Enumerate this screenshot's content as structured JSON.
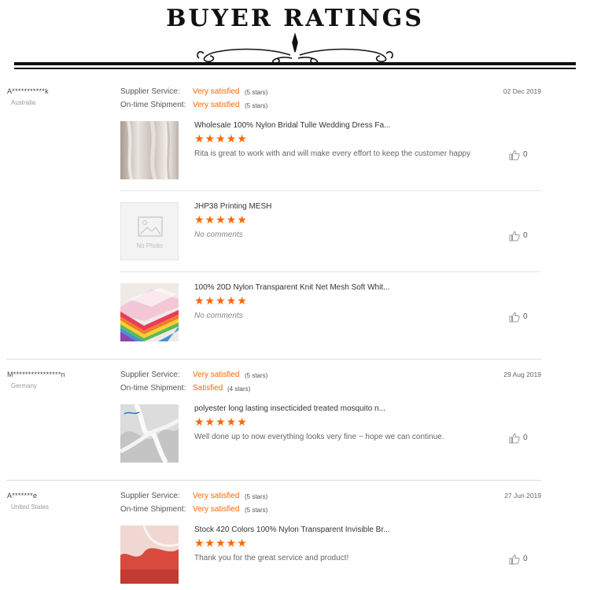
{
  "header": {
    "title": "BUYER RATINGS"
  },
  "labels": {
    "supplier_service": "Supplier Service:",
    "ontime_shipment": "On-time Shipment:"
  },
  "colors": {
    "accent": "#ff6600",
    "rule": "#111111"
  },
  "reviews": [
    {
      "buyer": "A***********k",
      "country": "Australia",
      "date": "02 Dec 2019",
      "supplier_service": {
        "text": "Very satisfied",
        "stars": "(5 stars)"
      },
      "ontime_shipment": {
        "text": "Very satisfied",
        "stars": "(5 stars)"
      },
      "items": [
        {
          "title": "Wholesale 100% Nylon Bridal Tulle Wedding Dress Fa...",
          "stars": "★★★★★",
          "rating": 5,
          "comment": "Rita is great to work with and will make every effort to keep the customer happy",
          "likes": "0"
        },
        {
          "title": "JHP38 Printing MESH",
          "stars": "★★★★★",
          "rating": 5,
          "comment": "No comments",
          "likes": "0",
          "no_photo_label": "No Photo"
        },
        {
          "title": "100% 20D Nylon Transparent Knit Net Mesh Soft Whit...",
          "stars": "★★★★★",
          "rating": 5,
          "comment": "No comments",
          "likes": "0"
        }
      ]
    },
    {
      "buyer": "M****************n",
      "country": "Germany",
      "date": "29 Aug 2019",
      "supplier_service": {
        "text": "Very satisfied",
        "stars": "(5 stars)"
      },
      "ontime_shipment": {
        "text": "Satisfied",
        "stars": "(4 stars)"
      },
      "items": [
        {
          "title": "polyester long lasting insecticided treated mosquito n...",
          "stars": "★★★★★",
          "rating": 5,
          "comment": "Well done up to now everything looks very fine ~ hope we can continue.",
          "likes": "0"
        }
      ]
    },
    {
      "buyer": "A*******e",
      "country": "United States",
      "date": "27 Jun 2019",
      "supplier_service": {
        "text": "Very satisfied",
        "stars": "(5 stars)"
      },
      "ontime_shipment": {
        "text": "Very satisfied",
        "stars": "(5 stars)"
      },
      "items": [
        {
          "title": "Stock 420 Colors 100% Nylon Transparent Invisible Br...",
          "stars": "★★★★★",
          "rating": 5,
          "comment": "Thank you for the great service and product!",
          "likes": "0"
        }
      ]
    }
  ]
}
